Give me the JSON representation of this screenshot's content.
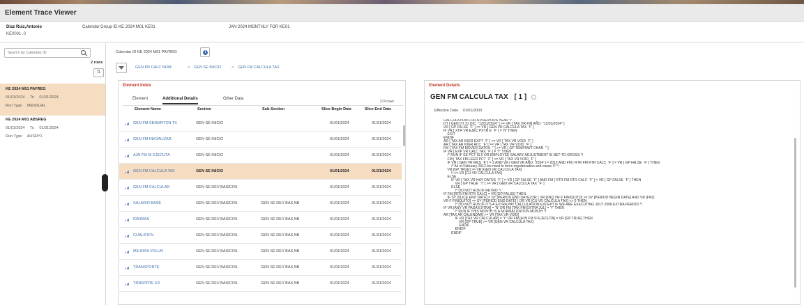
{
  "app": {
    "title": "Element Trace Viewer"
  },
  "header": {
    "employee_name": "Diaz Ruiz,Antonio",
    "employee_id": "KE0001 .0",
    "calendar_group": "Calendar Group ID  KE 2024 M01 KE01",
    "calendar_group_desc": "JAN 2024 MONTHLY FOR KE01"
  },
  "left": {
    "search_placeholder": "Search by Calendar ID",
    "rows_count": "2 rows",
    "sort_glyph": "⇅",
    "calendars": [
      {
        "id": "KE 2024 M01 PAYREG",
        "date_from": "01/01/2024",
        "to": "To",
        "date_to": "01/31/2024",
        "run_type_label": "Run Type",
        "run_type": "MENSUAL"
      },
      {
        "id": "KE 2024 M01 ABSREG",
        "date_from": "01/01/2024",
        "to": "To",
        "date_to": "01/31/2024",
        "run_type_label": "Run Type",
        "run_type": "AUSRY1"
      }
    ]
  },
  "main": {
    "calendar_id": "Calendar ID  KE 2024 M01 PAYREG",
    "info_glyph": "i",
    "breadcrumbs": [
      "GEN PR CALC NOM",
      "GEN SE INICIO",
      "GEN FM CALCULA TAX"
    ],
    "breadcrumb_sep": ">"
  },
  "element_index": {
    "title": "Element Index",
    "tabs": [
      "Element",
      "Additional Details",
      "Other Data"
    ],
    "total_rows": "274 rows",
    "columns": [
      "Element Name",
      "Section",
      "Sub-Section",
      "Slice Begin Date",
      "Slice End Date"
    ],
    "rows": [
      [
        "GEN FM SEGMNTCN TX",
        "GEN SE INICIO",
        "",
        "01/01/2024",
        "01/31/2024"
      ],
      [
        "GEN FM INICIALIZAR",
        "GEN SE INICIO",
        "",
        "01/01/2024",
        "01/31/2024"
      ],
      [
        "AJN FM SI EJECUTA",
        "GEN SE INICIO",
        "",
        "01/01/2024",
        "01/31/2024"
      ],
      [
        "GEN FM CALCULA TAX",
        "GEN SE INICIO",
        "",
        "01/01/2024",
        "01/31/2024"
      ],
      [
        "GEN FM CALCULAR",
        "GEN SE DEV BASICOS",
        "",
        "01/01/2024",
        "01/31/2024"
      ],
      [
        "SALARIO BASE",
        "GEN SE DEV BASICOS",
        "GEN SE DEV BAS NB",
        "01/01/2024",
        "01/31/2024"
      ],
      [
        "IDIOMAS",
        "GEN SE DEV BASICOS",
        "GEN SE DEV BAS NB",
        "01/01/2024",
        "01/31/2024"
      ],
      [
        "CUALIFICN",
        "GEN SE DEV BASICOS",
        "GEN SE DEV BAS NB",
        "01/01/2024",
        "01/31/2024"
      ],
      [
        "MEJORA VOLUN",
        "GEN SE DEV BASICOS",
        "GEN SE DEV BAS NB",
        "01/01/2024",
        "01/31/2024"
      ],
      [
        "TRANSPORTE",
        "GEN SE DEV BASICOS",
        "GEN SE DEV BAS NB",
        "01/01/2024",
        "01/31/2024"
      ],
      [
        "TRNSPRTE EX",
        "GEN SE DEV BASICOS",
        "GEN SE DEV BAS NB",
        "01/01/2024",
        "01/31/2024"
      ]
    ],
    "selected_row": 3
  },
  "element_details": {
    "title": "Element Details",
    "element_name": "GEN FM CALCULA TAX",
    "instance": "[ 1 ]",
    "effective_label": "Effective Date",
    "effective_date": "01/01/2000",
    "code_lines": [
      "CALCULATION FOR A PREVIOUS YEAR */",
      "DT [ GEN DT 31 DIC  \"12/31/2024\" ] >= VR [ TAX VR FIN AÑO  \"12/31/2024\" ]",
      "VR [ GP FALSE  'F' ] >= VR [ GEN VR CALCULA TAX  'F' ]",
      "IF VR [ XTR VR EJEC PXTR E  'F' ] = 'N' THEN",
      "    EXIT",
      "ENDIF",
      "AR [ TAX AR INGR EXPT  'F' ] >= VR [ TAX VR VOID  'F' ]",
      "AR [ TAX AR INGR ACC  'F' ] >= VR [ TAX VR VOID  'F' ]",
      "FM [ TAX FM MOVER DATOS  '' ] >= VR [ GP TEMPSWT CHAR  '' ]",
      "IF VR [ EXP VR CALC TAX  'F' ] = 'Y' THEN",
      "    /* RUN IF EE PCT IS 0 OR EMPLOYEE SALARY ADJUSTMENT IS NET-TO-GROSS */",
      "    FM [ TAX FM LEER PCT  'F' ] >= VR [ TAX VR VOID  'F' ]",
      "    IF VR [ GEN VR MES  'F' ] = 2 AND VR [ GEN VR AÑO  '2024' ] = 2012 AND FM [ RTR FM RTR CALC  'F' ] = VR [ GP FALSE  'F' ] THEN",
      "        /* As of February 2012 we need to force regularization and cause !!! */",
      "    VR [GP TRUE] >= VR [GEN VR CALCULA TAX]",
      "        !! >= VR [CU VR CALCULA TAX]",
      "    ELSE",
      "        IF VR [ TAX VR HAY DATOS  'F' ] = VR [ GP FALSE  'F' ] AND FM [ RTR FM RTR CALC  'F' ] = VR [ GP FALSE  'F' ] THEN",
      "            VR [ GP TRUE  'T' ] >= VR [ GEN VR CALCULA TAX  'F' ]",
      "        ELSE",
      "",
      "            /* DO NOT RUN IF RETRO */",
      "IF FM [RTR FM RTR CALC] = VR [GP FALSE] THEN",
      "    IF SY [SLICE END DATE] = SY [PERIOD END DATE] OR ( VR [FNQ VR F FINIQUITO] >= SY [PERIOD BEGIN DATE] AND VR [FNQ",
      "VR F FINIQUITO] <= SY [PERIOD END DATE] ) OR VR [CU VR CALCULA TAX] <> 0 THEN",
      "            /* DO NOT RUN IF IT'S A EXTRA PAY CALCULATION EXCEPT IF WE ARE EXECUTING JULY 2008 EXTRA PERIOD */",
      "IF VR [ANY VR PAGA EXTRA] = 'N' OR FM [TAX FM EXTRA JUL] = 'Y' THEN",
      "            /* RUN IF THIS MONTH IS A NORMALIZATION MONTH */",
      "AR [TAX AR CALENDAR] >= VR [TAX VR VOID]",
      "            IF VR [TAX VR CALCULAR] = 'Y' OR FM [AJN FM SI EJECUTA] = VR [GP TRUE] THEN",
      "                VR [GP TRUE] >= VR [GEN VR CALCULA TAX]",
      "                ENDIF",
      "            ENDIF",
      "        ENDIF"
    ]
  },
  "colors": {
    "accent_red": "#c0392b",
    "link_blue": "#3d6ea8",
    "selection": "#f6dcc0"
  }
}
